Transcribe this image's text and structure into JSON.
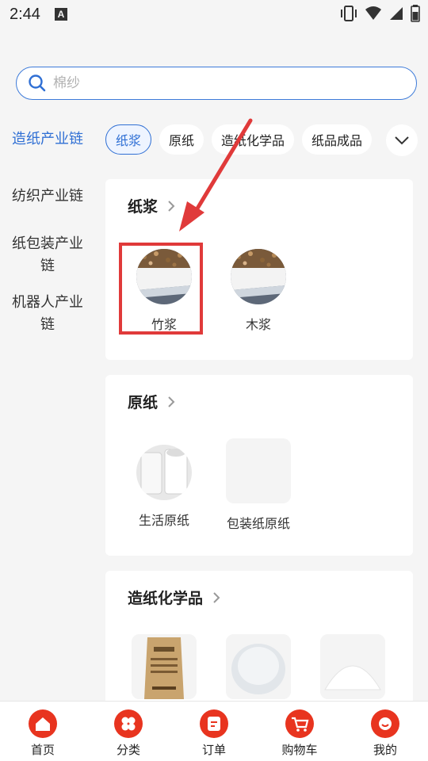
{
  "status_bar": {
    "time": "2:44",
    "notif_letter": "A"
  },
  "search": {
    "placeholder": "棉纱"
  },
  "left_nav": {
    "items": [
      {
        "label": "造纸产业链",
        "active": true
      },
      {
        "label": "纺织产业链",
        "active": false
      },
      {
        "label": "纸包装产业链",
        "active": false
      },
      {
        "label": "机器人产业链",
        "active": false
      }
    ]
  },
  "chips": [
    {
      "label": "纸浆",
      "active": true
    },
    {
      "label": "原纸",
      "active": false
    },
    {
      "label": "造纸化学品",
      "active": false
    },
    {
      "label": "纸品成品",
      "active": false
    }
  ],
  "sections": [
    {
      "title": "纸浆",
      "products": [
        {
          "name": "竹浆",
          "icon": "pulp-image"
        },
        {
          "name": "木浆",
          "icon": "pulp-image"
        }
      ]
    },
    {
      "title": "原纸",
      "products": [
        {
          "name": "生活原纸",
          "icon": "paper-roll-image"
        },
        {
          "name": "包装纸原纸",
          "icon": "blank-image"
        }
      ]
    },
    {
      "title": "造纸化学品",
      "products": [
        {
          "name": "",
          "icon": "chemical-bag-image"
        },
        {
          "name": "",
          "icon": "white-granules-image"
        },
        {
          "name": "",
          "icon": "white-powder-image"
        }
      ]
    }
  ],
  "bottom_nav": {
    "items": [
      {
        "label": "首页",
        "icon": "home-icon"
      },
      {
        "label": "分类",
        "icon": "category-icon"
      },
      {
        "label": "订单",
        "icon": "order-icon"
      },
      {
        "label": "购物车",
        "icon": "cart-icon"
      },
      {
        "label": "我的",
        "icon": "profile-icon"
      }
    ]
  },
  "colors": {
    "accent": "#2f6fd4",
    "highlight": "#e03a3a",
    "tab_icon": "#e8341f"
  }
}
